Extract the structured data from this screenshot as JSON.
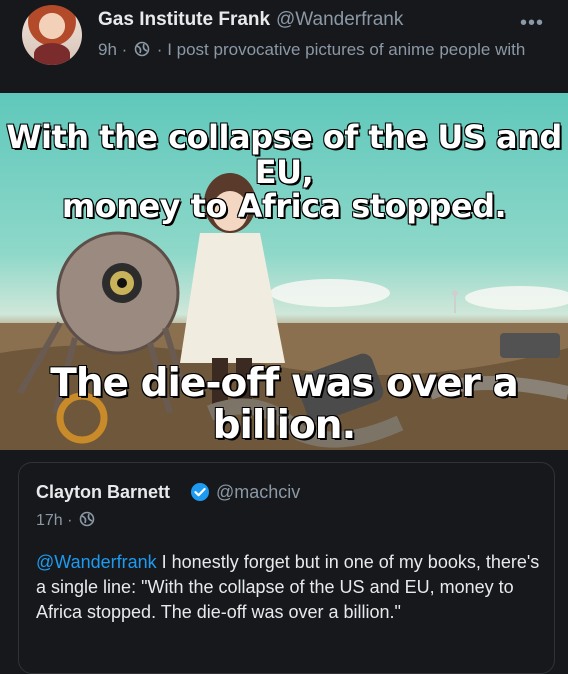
{
  "post": {
    "display_name": "Gas Institute Frank",
    "handle": "@Wanderfrank",
    "time": "9h",
    "separator": "·",
    "bio": "I post provocative pictures of anime people with"
  },
  "meme": {
    "top_line_1": "With the collapse of the US and EU,",
    "top_line_2": "money to Africa stopped.",
    "bottom_line": "The die-off was over a billion."
  },
  "quote": {
    "display_name": "Clayton Barnett",
    "handle": "@machciv",
    "time": "17h",
    "separator": "·",
    "mention": "@Wanderfrank",
    "text": " I honestly forget but in one of my books, there's a single line: \"With the collapse of the US and EU, money to Africa stopped. The die-off was over a billion.\""
  },
  "icons": {
    "more": "more-options-icon",
    "globe": "globe-icon",
    "verified": "verified-badge-icon"
  },
  "colors": {
    "background": "#16181c",
    "muted": "#8b98a5",
    "link": "#1d9bf0"
  }
}
